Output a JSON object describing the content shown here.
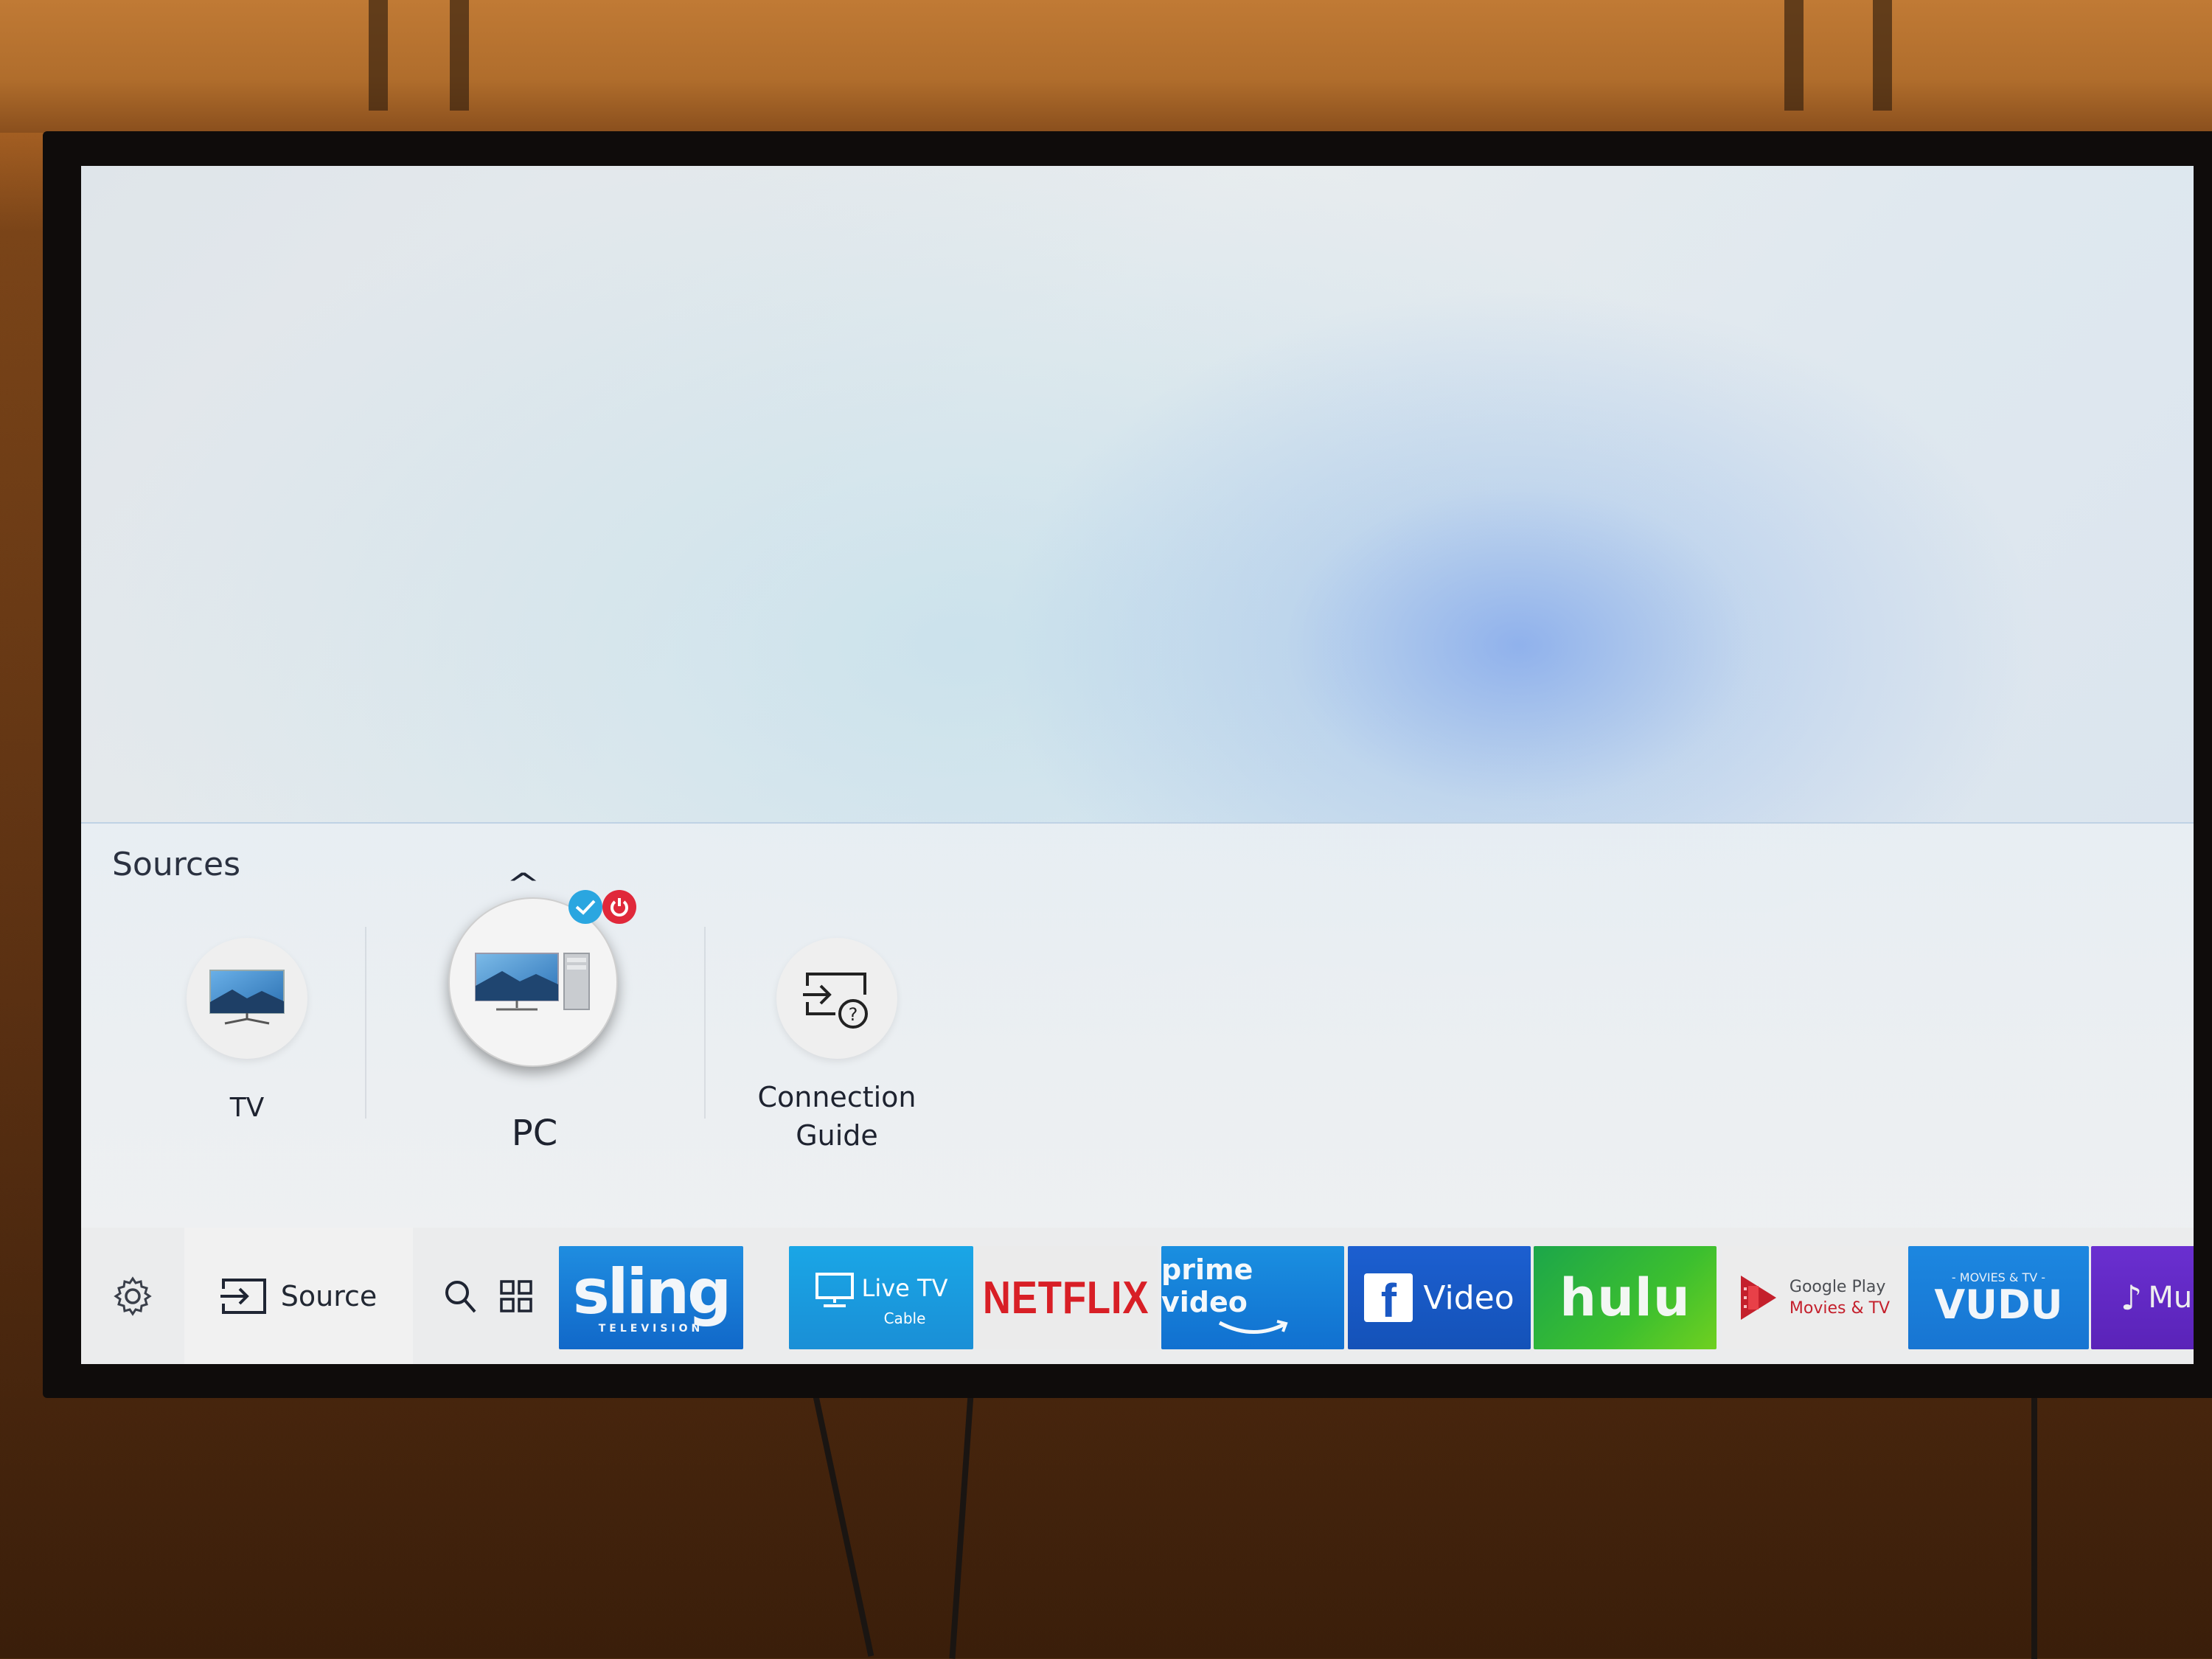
{
  "sources": {
    "title": "Sources",
    "items": [
      {
        "label": "TV",
        "icon": "tv-icon",
        "focused": false
      },
      {
        "label": "PC",
        "icon": "pc-icon",
        "focused": true,
        "badges": [
          "check-icon",
          "power-icon"
        ]
      },
      {
        "label_line1": "Connection",
        "label_line2": "Guide",
        "icon": "connection-guide-icon",
        "focused": false
      }
    ]
  },
  "appbar": {
    "settings_icon": "gear-icon",
    "source_label": "Source",
    "search_icon": "search-icon",
    "apps_icon": "apps-grid-icon",
    "tiles": [
      {
        "id": "sling",
        "label": "sling",
        "sublabel": "TELEVISION",
        "color": "#1a7fd8"
      },
      {
        "id": "live-tv",
        "label": "Live TV",
        "sublabel": "Cable",
        "color": "#1a9ee0"
      },
      {
        "id": "netflix",
        "label": "NETFLIX",
        "color": "#d81f26"
      },
      {
        "id": "prime-video",
        "label": "prime video",
        "color": "#1a86db"
      },
      {
        "id": "facebook-video",
        "label": "Video",
        "color": "#1a58c4"
      },
      {
        "id": "hulu",
        "label": "hulu",
        "color": "#3cb63a"
      },
      {
        "id": "google-play",
        "label_line1": "Google Play",
        "label_line2": "Movies & TV",
        "color": "#d0222e"
      },
      {
        "id": "vudu",
        "label": "VUDU",
        "sublabel": "- MOVIES & TV -",
        "color": "#1c80dc"
      },
      {
        "id": "music",
        "label": "Mu",
        "color": "#6228c4"
      }
    ]
  }
}
